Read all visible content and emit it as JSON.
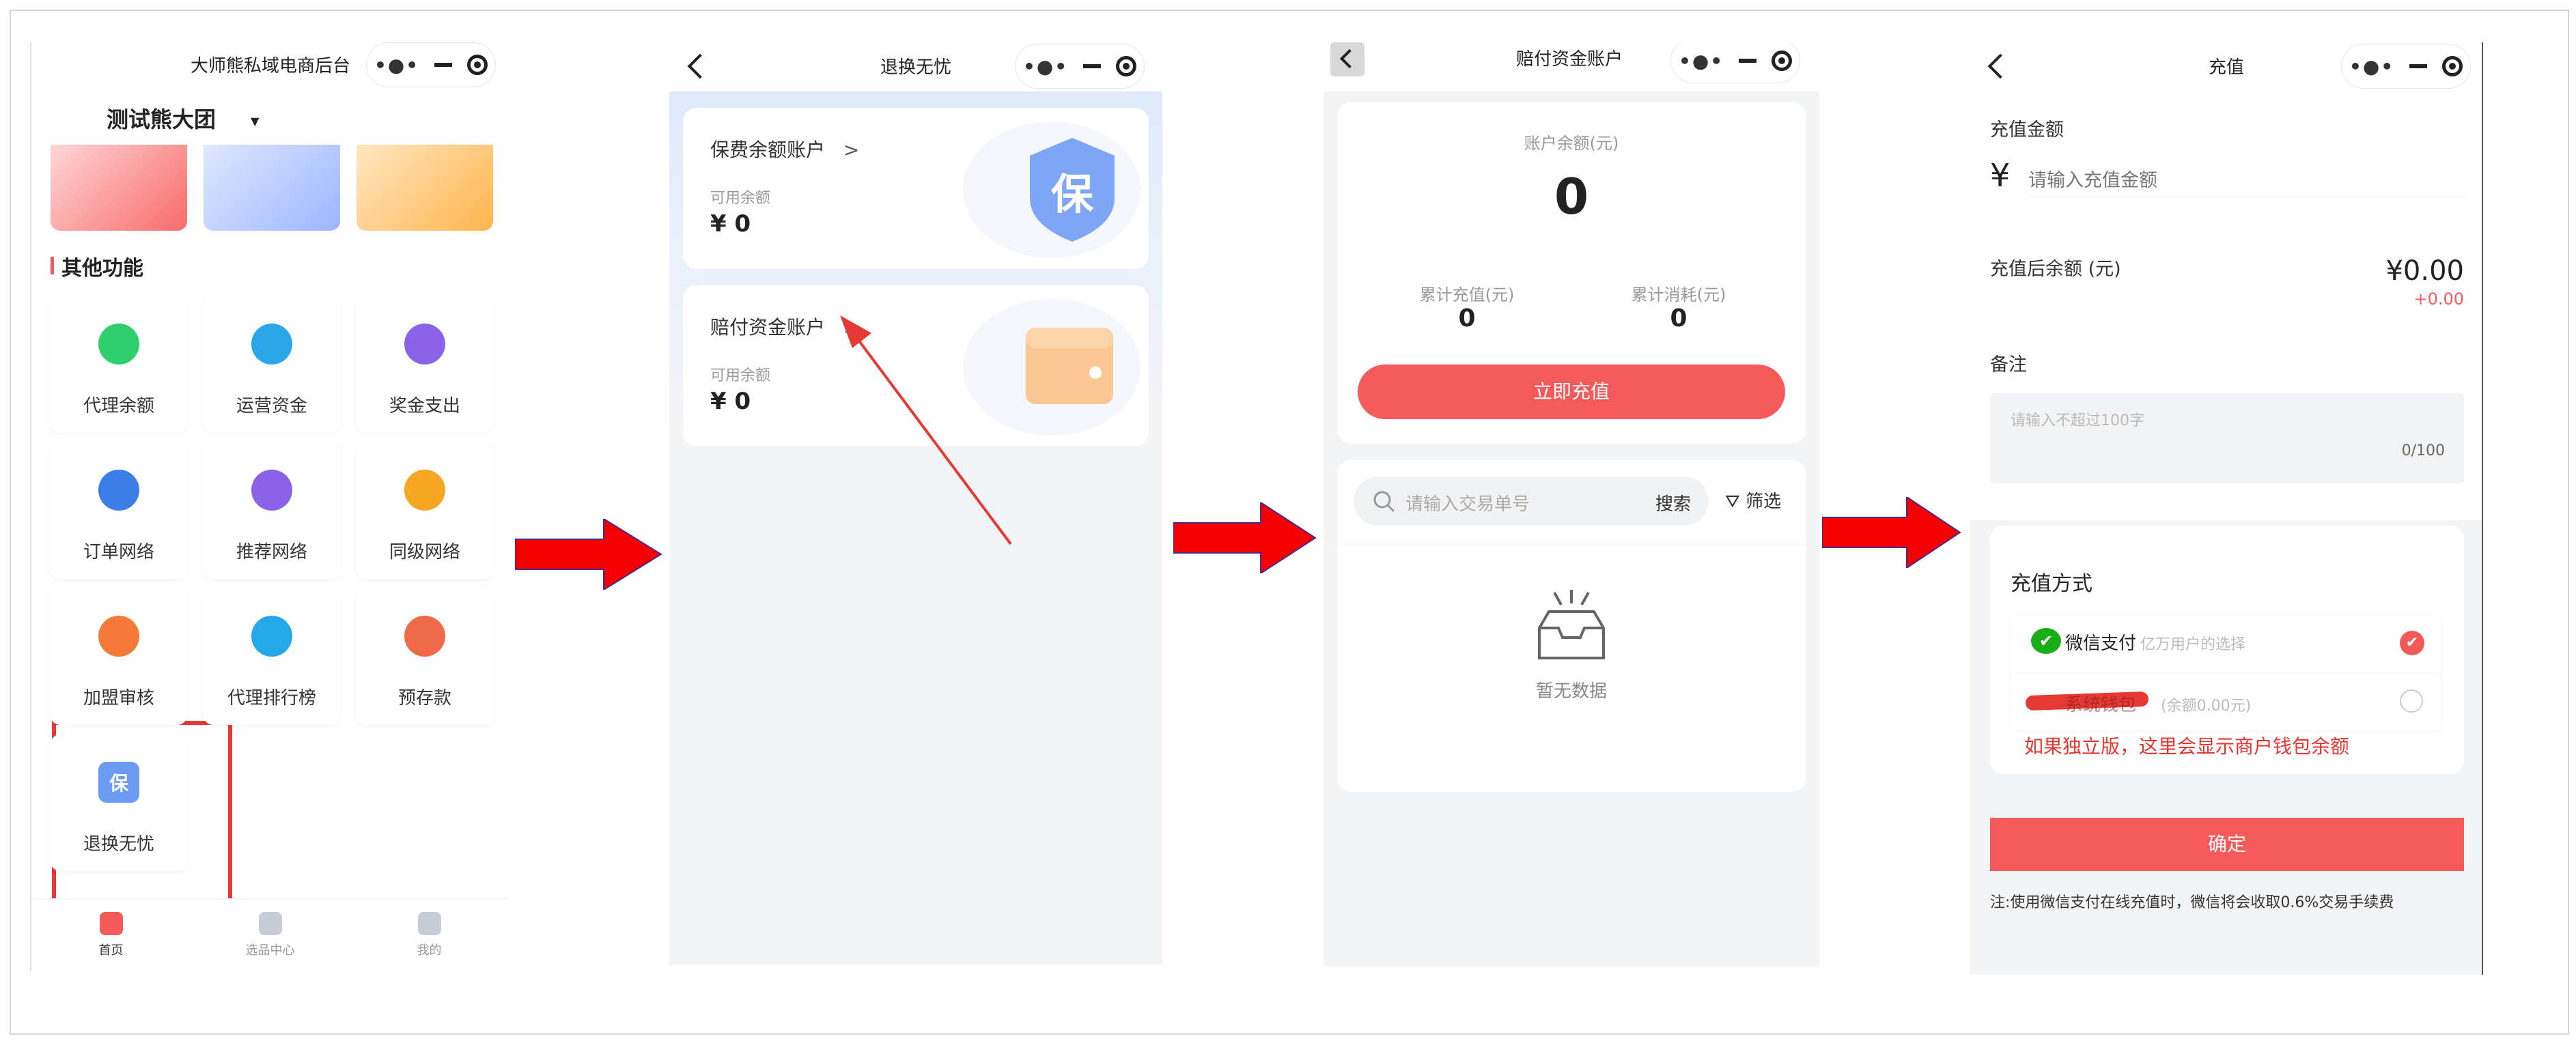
{
  "screen1": {
    "title": "大师熊私域电商后台",
    "org_name": "测试熊大团",
    "section_title": "其他功能",
    "grid": [
      {
        "label": "代理余额",
        "icon": "money-bag-icon",
        "color": "#2fcf6f"
      },
      {
        "label": "运营资金",
        "icon": "chart-icon",
        "color": "#2aa7e6"
      },
      {
        "label": "奖金支出",
        "icon": "wallet-icon",
        "color": "#8a63e8"
      },
      {
        "label": "订单网络",
        "icon": "network-icon",
        "color": "#3b7ee8"
      },
      {
        "label": "推荐网络",
        "icon": "network-icon",
        "color": "#8a63e8"
      },
      {
        "label": "同级网络",
        "icon": "network-icon",
        "color": "#f5a623"
      },
      {
        "label": "加盟审核",
        "icon": "review-icon",
        "color": "#f57a3a"
      },
      {
        "label": "代理排行榜",
        "icon": "rank-icon",
        "color": "#25a8e8"
      },
      {
        "label": "预存款",
        "icon": "deposit-icon",
        "color": "#f06a4a"
      },
      {
        "label": "退换无忧",
        "icon": "shield-icon",
        "color": "#6b9cf0",
        "badge": "保"
      }
    ],
    "tabs": [
      {
        "label": "首页",
        "icon": "home-icon"
      },
      {
        "label": "选品中心",
        "icon": "select-icon"
      },
      {
        "label": "我的",
        "icon": "user-icon"
      }
    ]
  },
  "screen2": {
    "title": "退换无忧",
    "accounts": [
      {
        "name": "保费余额账户",
        "sub": "可用余额",
        "amount": "¥ 0",
        "badge": "保"
      },
      {
        "name": "赔付资金账户",
        "sub": "可用余额",
        "amount": "¥ 0"
      }
    ]
  },
  "screen3": {
    "title": "赔付资金账户",
    "balance_label": "账户余额(元)",
    "balance": "0",
    "recharge_total_label": "累计充值(元)",
    "recharge_total": "0",
    "consume_total_label": "累计消耗(元)",
    "consume_total": "0",
    "recharge_button": "立即充值",
    "search_placeholder": "请输入交易单号",
    "search_button": "搜索",
    "filter_button": "筛选",
    "empty_text": "暂无数据"
  },
  "screen4": {
    "title": "充值",
    "amount_label": "充值金额",
    "currency_symbol": "¥",
    "amount_placeholder": "请输入充值金额",
    "after_label": "充值后余额 (元)",
    "after_value": "¥0.00",
    "after_delta": "+0.00",
    "remark_label": "备注",
    "remark_placeholder": "请输入不超过100字",
    "remark_count": "0/100",
    "method_title": "充值方式",
    "methods": [
      {
        "name": "微信支付",
        "desc": "亿万用户的选择",
        "selected": true
      },
      {
        "name": "系统钱包",
        "desc": "(余额0.00元)",
        "selected": false
      }
    ],
    "annotation": "如果独立版，这里会显示商户钱包余额",
    "confirm_button": "确定",
    "note": "注:使用微信支付在线充值时，微信将会收取0.6%交易手续费"
  },
  "colors": {
    "accent": "#f55a5a",
    "annotation_red": "#e8342f",
    "arrow_red": "#f40000",
    "page_bg": "#f3f4f6"
  }
}
